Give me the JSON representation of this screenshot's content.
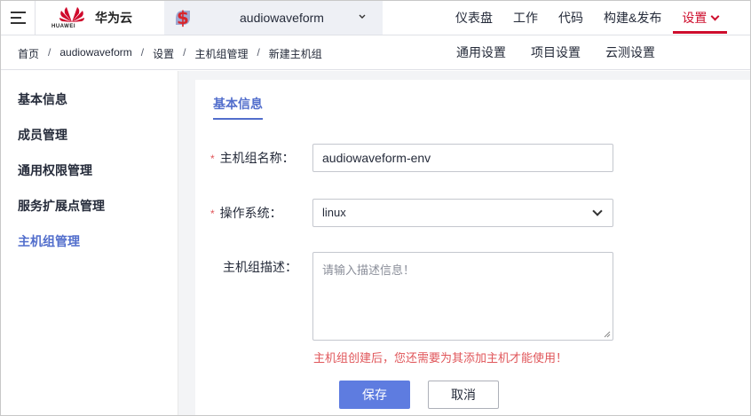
{
  "brand": {
    "company": "HUAWEI",
    "product": "华为云"
  },
  "project": {
    "name": "audiowaveform",
    "icon": "dollar-project-icon"
  },
  "top_nav": [
    {
      "label": "仪表盘"
    },
    {
      "label": "工作"
    },
    {
      "label": "代码"
    },
    {
      "label": "构建&发布"
    },
    {
      "label": "设置",
      "active": true
    }
  ],
  "breadcrumb": [
    "首页",
    "audiowaveform",
    "设置",
    "主机组管理",
    "新建主机组"
  ],
  "breadcrumb_sep": "/",
  "sub_nav": [
    "通用设置",
    "项目设置",
    "云测设置"
  ],
  "sidebar": {
    "items": [
      {
        "label": "基本信息"
      },
      {
        "label": "成员管理"
      },
      {
        "label": "通用权限管理"
      },
      {
        "label": "服务扩展点管理"
      },
      {
        "label": "主机组管理",
        "active": true
      }
    ]
  },
  "form": {
    "section_title": "基本信息",
    "required_mark": "*",
    "name_label": "主机组名称：",
    "name_value": "audiowaveform-env",
    "os_label": "操作系统：",
    "os_value": "linux",
    "desc_label": "主机组描述：",
    "desc_placeholder": "请输入描述信息！",
    "warning": "主机组创建后，您还需要为其添加主机才能使用！",
    "save_label": "保存",
    "cancel_label": "取消"
  },
  "colors": {
    "accent": "#526ecc",
    "primary_button": "#5e7ce0",
    "active_nav": "#ce0e2d",
    "warning": "#e0565a"
  }
}
